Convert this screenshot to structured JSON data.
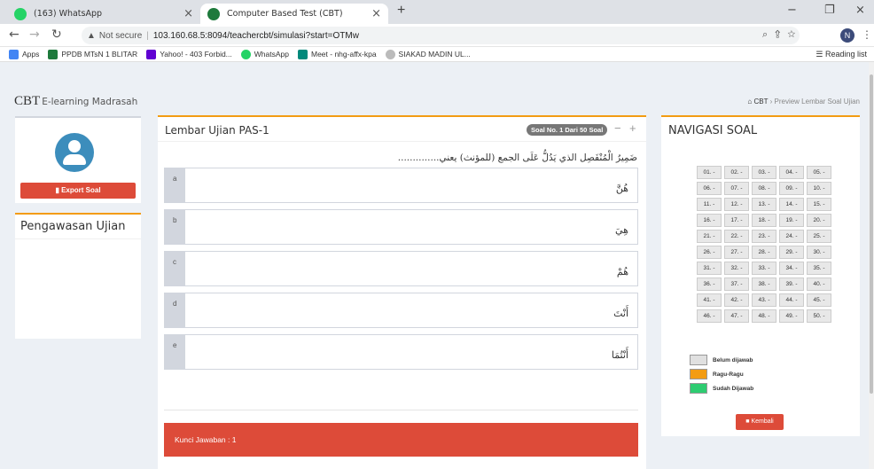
{
  "browser": {
    "tabs": [
      {
        "title": "(163) WhatsApp",
        "close": "×"
      },
      {
        "title": "Computer Based Test (CBT)",
        "close": "×"
      }
    ],
    "new_tab": "+",
    "window_controls": {
      "minimize": "−",
      "restore": "❐",
      "close": "×"
    },
    "security": "Not secure",
    "url": "103.160.68.5:8094/teachercbt/simulasi?start=OTMw",
    "profile_initial": "N",
    "bookmarks": [
      "Apps",
      "PPDB MTsN 1 BLITAR",
      "Yahoo! - 403 Forbid...",
      "WhatsApp",
      "Meet - nhg-affx-kpa",
      "SIAKAD MADIN UL..."
    ],
    "reading_list": "Reading list"
  },
  "header": {
    "brand": "CBT",
    "brand_sub": "E-learning Madrasah",
    "breadcrumb_home": "CBT",
    "breadcrumb_current": "Preview Lembar Soal Ujian"
  },
  "sidebar": {
    "export_label": "Export Soal",
    "pengawasan_title": "Pengawasan Ujian"
  },
  "exam": {
    "title": "Lembar Ujian PAS-1",
    "badge": "Soal No. 1 Dari 50 Soal",
    "question": "ضَمِيرُ الْمُنْفَصِل الذي يَدُلُّ عَلَى الجمع (للمؤنث) يعني..............",
    "options": [
      {
        "key": "a",
        "text": "هُنَّ"
      },
      {
        "key": "b",
        "text": "هِيَ"
      },
      {
        "key": "c",
        "text": "هُمْ"
      },
      {
        "key": "d",
        "text": "أَنْتَ"
      },
      {
        "key": "e",
        "text": "أَنْتُمَا"
      }
    ],
    "answer_key": "Kunci Jawaban : 1"
  },
  "navigator": {
    "title": "NAVIGASI SOAL",
    "cells": [
      "01. -",
      "02. -",
      "03. -",
      "04. -",
      "05. -",
      "06. -",
      "07. -",
      "08. -",
      "09. -",
      "10. -",
      "11. -",
      "12. -",
      "13. -",
      "14. -",
      "15. -",
      "16. -",
      "17. -",
      "18. -",
      "19. -",
      "20. -",
      "21. -",
      "22. -",
      "23. -",
      "24. -",
      "25. -",
      "26. -",
      "27. -",
      "28. -",
      "29. -",
      "30. -",
      "31. -",
      "32. -",
      "33. -",
      "34. -",
      "35. -",
      "36. -",
      "37. -",
      "38. -",
      "39. -",
      "40. -",
      "41. -",
      "42. -",
      "43. -",
      "44. -",
      "45. -",
      "46. -",
      "47. -",
      "48. -",
      "49. -",
      "50. -"
    ],
    "legend": [
      {
        "label": "Belum dijawab",
        "color": "#e0e0e0"
      },
      {
        "label": "Ragu-Ragu",
        "color": "#f39c12"
      },
      {
        "label": "Sudah Dijawab",
        "color": "#2ecc71"
      }
    ],
    "back_label": "Kembali"
  }
}
